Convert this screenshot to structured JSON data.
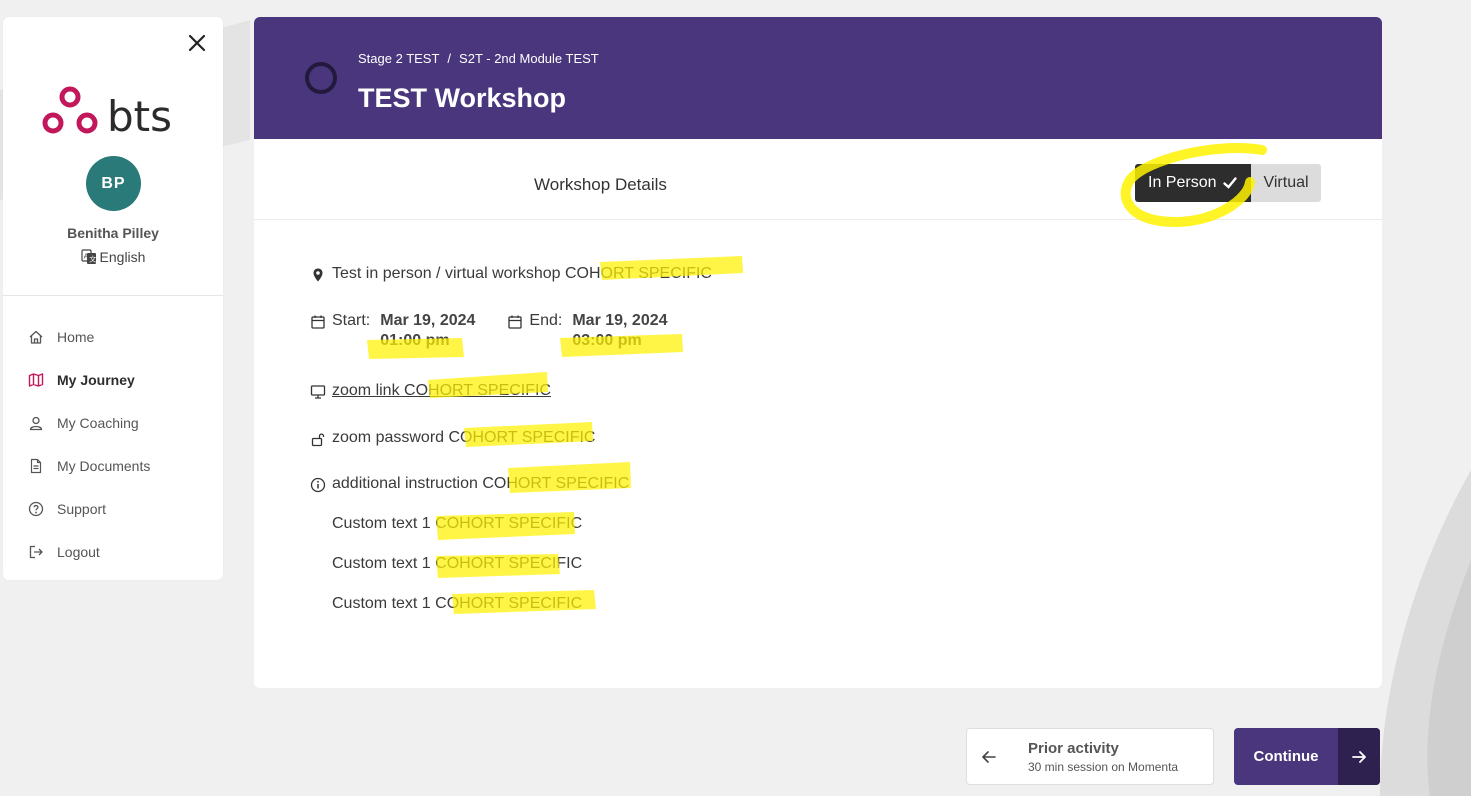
{
  "sidebar": {
    "user": {
      "initials": "BP",
      "name": "Benitha Pilley"
    },
    "language": "English",
    "nav": [
      {
        "label": "Home",
        "icon": "home-icon",
        "active": false
      },
      {
        "label": "My Journey",
        "icon": "map-icon",
        "active": true
      },
      {
        "label": "My Coaching",
        "icon": "user-icon",
        "active": false
      },
      {
        "label": "My Documents",
        "icon": "document-icon",
        "active": false
      },
      {
        "label": "Support",
        "icon": "help-icon",
        "active": false
      },
      {
        "label": "Logout",
        "icon": "logout-icon",
        "active": false
      }
    ]
  },
  "header": {
    "breadcrumb": [
      "Stage 2 TEST",
      "S2T - 2nd Module TEST"
    ],
    "breadcrumb_separator": "/",
    "title": "TEST Workshop"
  },
  "workshop": {
    "section_title": "Workshop Details",
    "mode_options": [
      "In Person",
      "Virtual"
    ],
    "selected_mode": "In Person",
    "location": "Test in person / virtual workshop COHORT SPECIFIC",
    "start_label": "Start:",
    "start_date": "Mar 19, 2024",
    "start_time": "01:00 pm",
    "end_label": "End:",
    "end_date": "Mar 19, 2024",
    "end_time": "03:00 pm",
    "zoom_link": "zoom link COHORT SPECIFIC",
    "zoom_password": "zoom password COHORT SPECIFIC",
    "additional_instruction": "additional instruction COHORT SPECIFIC",
    "custom_texts": [
      "Custom text 1 COHORT SPECIFIC",
      "Custom text 1 COHORT SPECIFIC",
      "Custom text 1 COHORT SPECIFIC"
    ]
  },
  "footer": {
    "prior_title": "Prior activity",
    "prior_subtitle": "30 min session on Momenta",
    "continue_label": "Continue"
  },
  "colors": {
    "brand_purple": "#4a367d",
    "brand_purple_dark": "#2e214f",
    "logo_magenta": "#c2185b",
    "avatar_teal": "#2a7a79",
    "highlight_yellow": "#fff200"
  }
}
